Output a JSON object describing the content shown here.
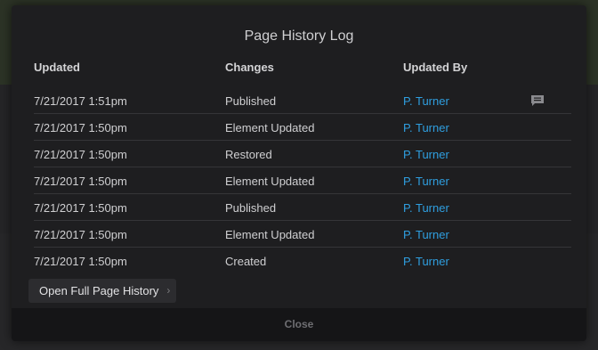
{
  "modal": {
    "title": "Page History Log",
    "columns": {
      "updated": "Updated",
      "changes": "Changes",
      "updated_by": "Updated By"
    },
    "rows": [
      {
        "updated": "7/21/2017 1:51pm",
        "change": "Published",
        "by": "P. Turner",
        "has_comment": true
      },
      {
        "updated": "7/21/2017 1:50pm",
        "change": "Element Updated",
        "by": "P. Turner",
        "has_comment": false
      },
      {
        "updated": "7/21/2017 1:50pm",
        "change": "Restored",
        "by": "P. Turner",
        "has_comment": false
      },
      {
        "updated": "7/21/2017 1:50pm",
        "change": "Element Updated",
        "by": "P. Turner",
        "has_comment": false
      },
      {
        "updated": "7/21/2017 1:50pm",
        "change": "Published",
        "by": "P. Turner",
        "has_comment": false
      },
      {
        "updated": "7/21/2017 1:50pm",
        "change": "Element Updated",
        "by": "P. Turner",
        "has_comment": false
      },
      {
        "updated": "7/21/2017 1:50pm",
        "change": "Created",
        "by": "P. Turner",
        "has_comment": false
      }
    ],
    "open_full_history_label": "Open Full Page History",
    "open_chevron": "›",
    "close_label": "Close"
  },
  "colors": {
    "link": "#2f9fe0",
    "modal_bg": "#1e1e20",
    "footer_bg": "#151517"
  },
  "icons": {
    "comment": "comment-icon"
  }
}
